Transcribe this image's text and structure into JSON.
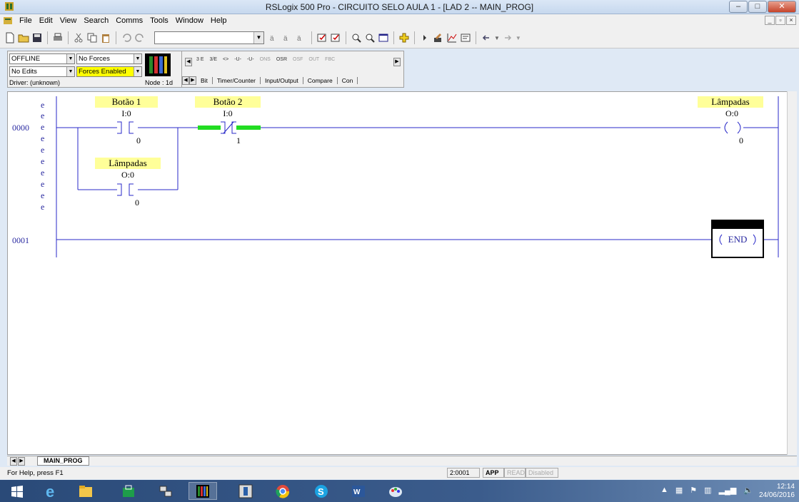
{
  "window": {
    "title": "RSLogix 500 Pro - CIRCUITO SELO AULA 1 - [LAD 2 -- MAIN_PROG]"
  },
  "menu": {
    "items": [
      "File",
      "Edit",
      "View",
      "Search",
      "Comms",
      "Tools",
      "Window",
      "Help"
    ]
  },
  "status_panel": {
    "mode": "OFFLINE",
    "forces": "No Forces",
    "edits": "No Edits",
    "forces_enabled": "Forces Enabled",
    "driver": "Driver: (unknown)",
    "node": "Node : 1d"
  },
  "palette": {
    "instructions": [
      "3 E",
      "3/E",
      "<>",
      "-U-",
      "-U-",
      "ONS",
      "OSR",
      "OSF",
      "OUT",
      "FBC"
    ],
    "tabs": [
      "Bit",
      "Timer/Counter",
      "Input/Output",
      "Compare",
      "Con"
    ]
  },
  "ladder": {
    "rungs": [
      {
        "number": "0000",
        "elements": [
          {
            "type": "XIC",
            "symbol": "Botão 1",
            "address": "I:0",
            "bit": "0"
          },
          {
            "type": "XIO",
            "symbol": "Botão 2",
            "address": "I:0",
            "bit": "1",
            "energized": true
          },
          {
            "type": "OTE",
            "symbol": "Lâmpadas",
            "address": "O:0",
            "bit": "0"
          },
          {
            "type": "XIC",
            "symbol": "Lâmpadas",
            "address": "O:0",
            "bit": "0",
            "branch": true
          }
        ]
      },
      {
        "number": "0001",
        "end_label": "END"
      }
    ],
    "marker": "e",
    "colors": {
      "rail": "#2828c8",
      "highlight": "#ffff99",
      "energized": "#22dd22"
    }
  },
  "sheet_tabs": [
    "MAIN_PROG"
  ],
  "statusbar": {
    "help": "For Help, press F1",
    "position": "2:0001",
    "mode": "APP",
    "read": "READ",
    "disabled": "Disabled"
  },
  "taskbar": {
    "time": "12:14",
    "date": "24/06/2016"
  }
}
